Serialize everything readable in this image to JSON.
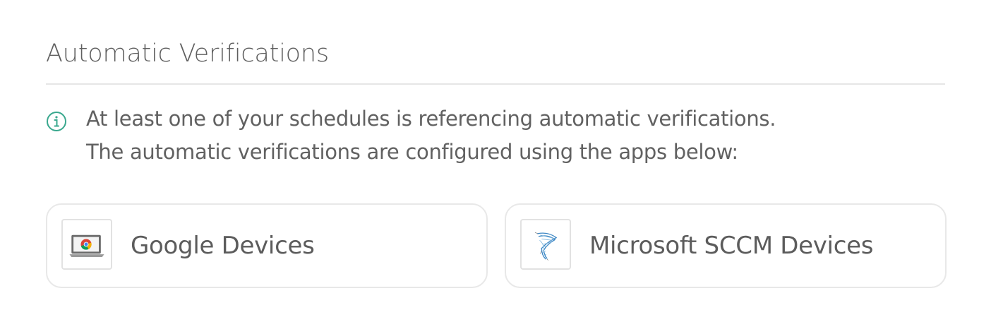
{
  "section": {
    "title": "Automatic Verifications"
  },
  "info": {
    "icon": "info-circle-icon",
    "line1": "At least one of your schedules is referencing automatic verifications.",
    "line2": "The automatic verifications are configured using the apps below:"
  },
  "apps": [
    {
      "label": "Google Devices",
      "icon": "chromebook-icon"
    },
    {
      "label": "Microsoft SCCM Devices",
      "icon": "sccm-icon"
    }
  ],
  "colors": {
    "accent": "#3aa88e",
    "text": "#5e5e5e",
    "border": "#e8e8e8"
  }
}
